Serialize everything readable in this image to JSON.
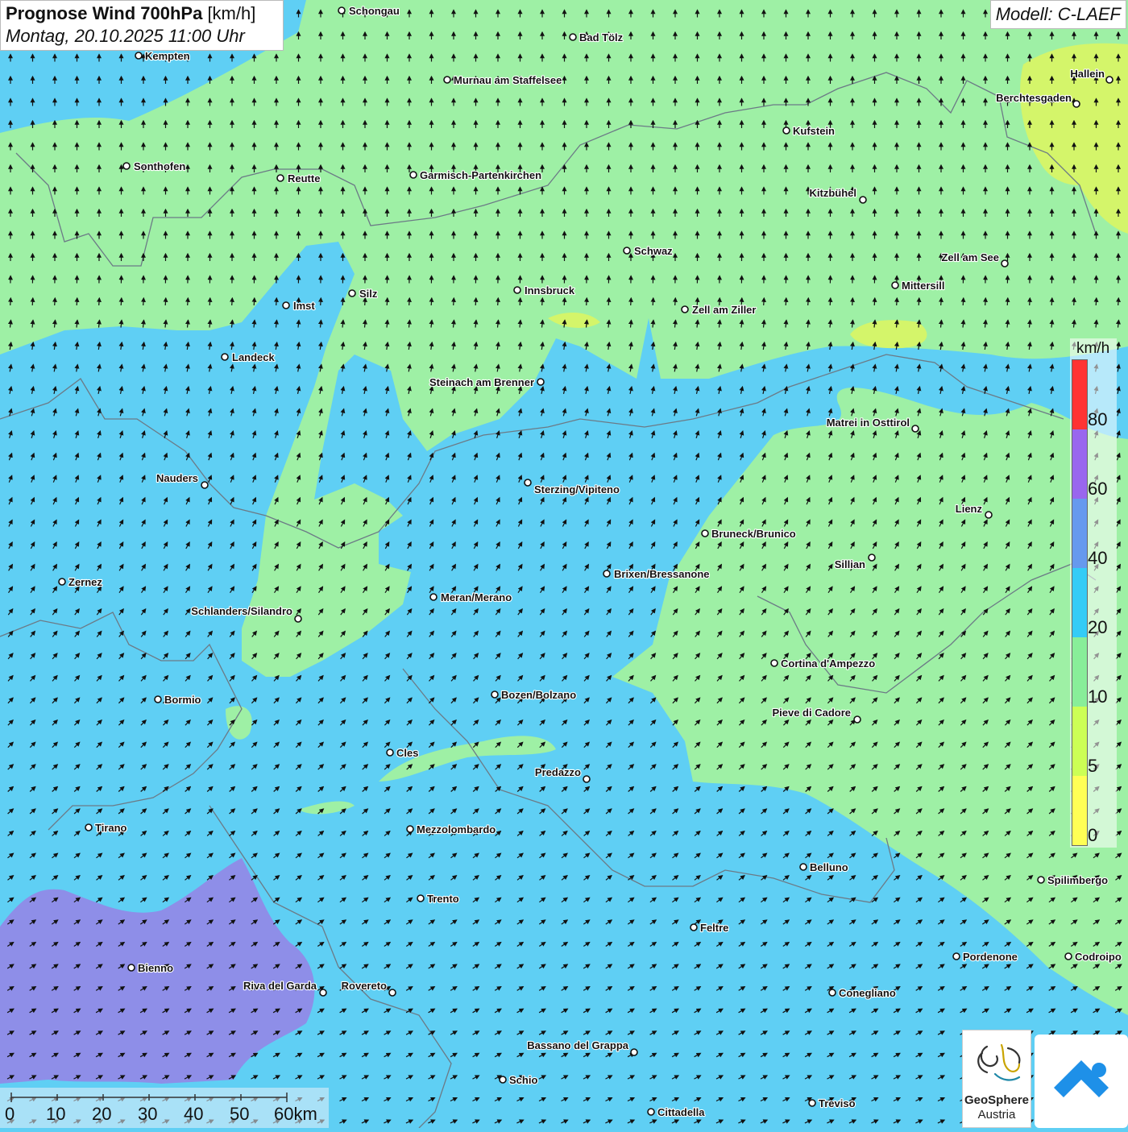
{
  "header": {
    "title_bold": "Prognose Wind 700hPa",
    "title_unit": "[km/h]",
    "subtitle": "Montag, 20.10.2025 11:00 Uhr",
    "model": "Modell: C-LAEF"
  },
  "legend": {
    "unit": "km/h",
    "ticks": [
      "80",
      "60",
      "40",
      "20",
      "10",
      "5",
      "0"
    ],
    "colors": [
      "#ff3333",
      "#9966ee",
      "#6699ee",
      "#33ccf6",
      "#88ee99",
      "#ccff55",
      "#ffff55"
    ]
  },
  "scale": {
    "ticks": [
      "0",
      "10",
      "20",
      "30",
      "40",
      "50",
      "60km"
    ]
  },
  "colors": {
    "light_blue": "#5fcff4",
    "green": "#9ef0a5",
    "purple": "#8e8ee8",
    "yellow_green": "#d4f56a",
    "border": "#6c7a86",
    "arrow": "#111111"
  },
  "wind": {
    "north_direction": "north",
    "south_direction": "north-east"
  },
  "cities": [
    {
      "name": "Schongau"
    },
    {
      "name": "Bad Tölz"
    },
    {
      "name": "Kempten"
    },
    {
      "name": "Murnau am Staffelsee"
    },
    {
      "name": "Hallein"
    },
    {
      "name": "Berchtesgaden"
    },
    {
      "name": "Kufstein"
    },
    {
      "name": "Sonthofen"
    },
    {
      "name": "Reutte"
    },
    {
      "name": "Garmisch-Partenkirchen"
    },
    {
      "name": "Kitzbühel"
    },
    {
      "name": "Schwaz"
    },
    {
      "name": "Zell am See"
    },
    {
      "name": "Mittersill"
    },
    {
      "name": "Innsbruck"
    },
    {
      "name": "Silz"
    },
    {
      "name": "Imst"
    },
    {
      "name": "Zell am Ziller"
    },
    {
      "name": "Landeck"
    },
    {
      "name": "Steinach am Brenner"
    },
    {
      "name": "Matrei in Osttirol"
    },
    {
      "name": "Nauders"
    },
    {
      "name": "Sterzing/Vipiteno"
    },
    {
      "name": "Lienz"
    },
    {
      "name": "Bruneck/Brunico"
    },
    {
      "name": "Sillian"
    },
    {
      "name": "Brixen/Bressanone"
    },
    {
      "name": "Zernez"
    },
    {
      "name": "Meran/Merano"
    },
    {
      "name": "Schlanders/Silandro"
    },
    {
      "name": "Cortina d'Ampezzo"
    },
    {
      "name": "Bozen/Bolzano"
    },
    {
      "name": "Bormio"
    },
    {
      "name": "Pieve di Cadore"
    },
    {
      "name": "Cles"
    },
    {
      "name": "Predazzo"
    },
    {
      "name": "Tirano"
    },
    {
      "name": "Mezzolombardo"
    },
    {
      "name": "Belluno"
    },
    {
      "name": "Spilimbergo"
    },
    {
      "name": "Trento"
    },
    {
      "name": "Feltre"
    },
    {
      "name": "Pordenone"
    },
    {
      "name": "Codroipo"
    },
    {
      "name": "Bienno"
    },
    {
      "name": "Riva del Garda"
    },
    {
      "name": "Rovereto"
    },
    {
      "name": "Conegliano"
    },
    {
      "name": "Bassano del Grappa"
    },
    {
      "name": "Schio"
    },
    {
      "name": "Treviso"
    },
    {
      "name": "Cittadella"
    }
  ],
  "logo": {
    "org_line1": "GeoSphere",
    "org_line2": "Austria"
  }
}
